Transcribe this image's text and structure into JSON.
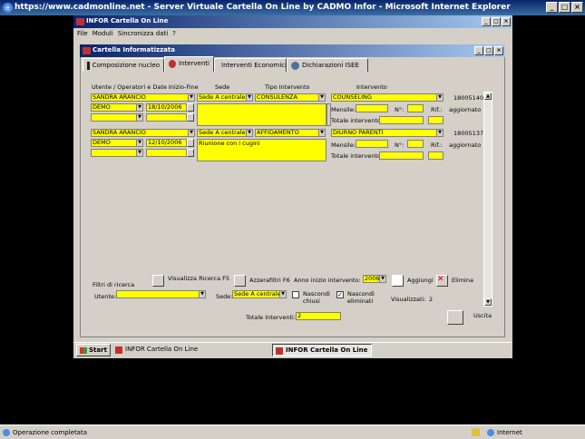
{
  "browser": {
    "title": "https://www.cadmonline.net - Server Virtuale Cartella On Line by CADMO Infor - Microsoft Internet Explorer",
    "status": "Operazione completata",
    "zone": "Internet"
  },
  "app": {
    "title": "INFOR Cartella On Line",
    "menu": [
      "File",
      "Moduli",
      "Sincronizza dati",
      "?"
    ]
  },
  "window": {
    "title": "Cartella Informatizzata",
    "tabs": [
      "Composizione nucleo",
      "Interventi",
      "Interventi Economici",
      "Dichiarazioni ISEE"
    ]
  },
  "headers": {
    "col1": "Utente / Operatori e Date Inizio-Fine",
    "col2": "Sede",
    "col3": "Tipo Intervento",
    "col4": "Intervento"
  },
  "records": [
    {
      "utente": "SANDRA ARANCIO",
      "operatore": "DEMO",
      "data_inizio": "18/10/2006",
      "sede": "Sede A centrale",
      "tipo": "CONSULENZA",
      "descrizione": "",
      "intervento": "COUNSELING",
      "codice": "18005140",
      "mensile_label": "Mensile:",
      "n_label": "N°:",
      "rif_label": "Rif.:",
      "stato": "aggiornato",
      "totale_label": "Totale intervento:"
    },
    {
      "utente": "SANDRA ARANCIO",
      "operatore": "DEMO",
      "data_inizio": "12/10/2006",
      "sede": "Sede A centrale",
      "tipo": "AFFIDAMENTO",
      "descrizione": "Riunione con i cugini",
      "intervento": "DIURNO PARENTI",
      "codice": "18005137",
      "mensile_label": "Mensile:",
      "n_label": "N°:",
      "rif_label": "Rif.:",
      "stato": "aggiornato",
      "totale_label": "Totale intervento:"
    }
  ],
  "filters": {
    "label": "Filtri di ricerca",
    "visualizza": "Visualizza Ricerca F5",
    "azzera": "Azzerafiltri  F6",
    "anno_label": "Anno inizio intervento:",
    "anno_value": "2006",
    "aggiungi": "Aggiungi",
    "elimina": "Elimina",
    "utente_label": "Utente:",
    "utente_value": "",
    "sede_label": "Sede:",
    "sede_value": "Sede A centrale",
    "nascondi_chiusi": "Nascondi chiusi",
    "nascondi_eliminati": "Nascondi eliminati",
    "visualizzati_label": "Visualizzati:",
    "visualizzati_value": "2"
  },
  "totale": {
    "label": "Totale Interventi:",
    "value": "2"
  },
  "uscita": "Uscita",
  "taskbar": {
    "start": "Start",
    "item1": "INFOR Cartella On Line",
    "item2": "INFOR Cartella On Line"
  }
}
